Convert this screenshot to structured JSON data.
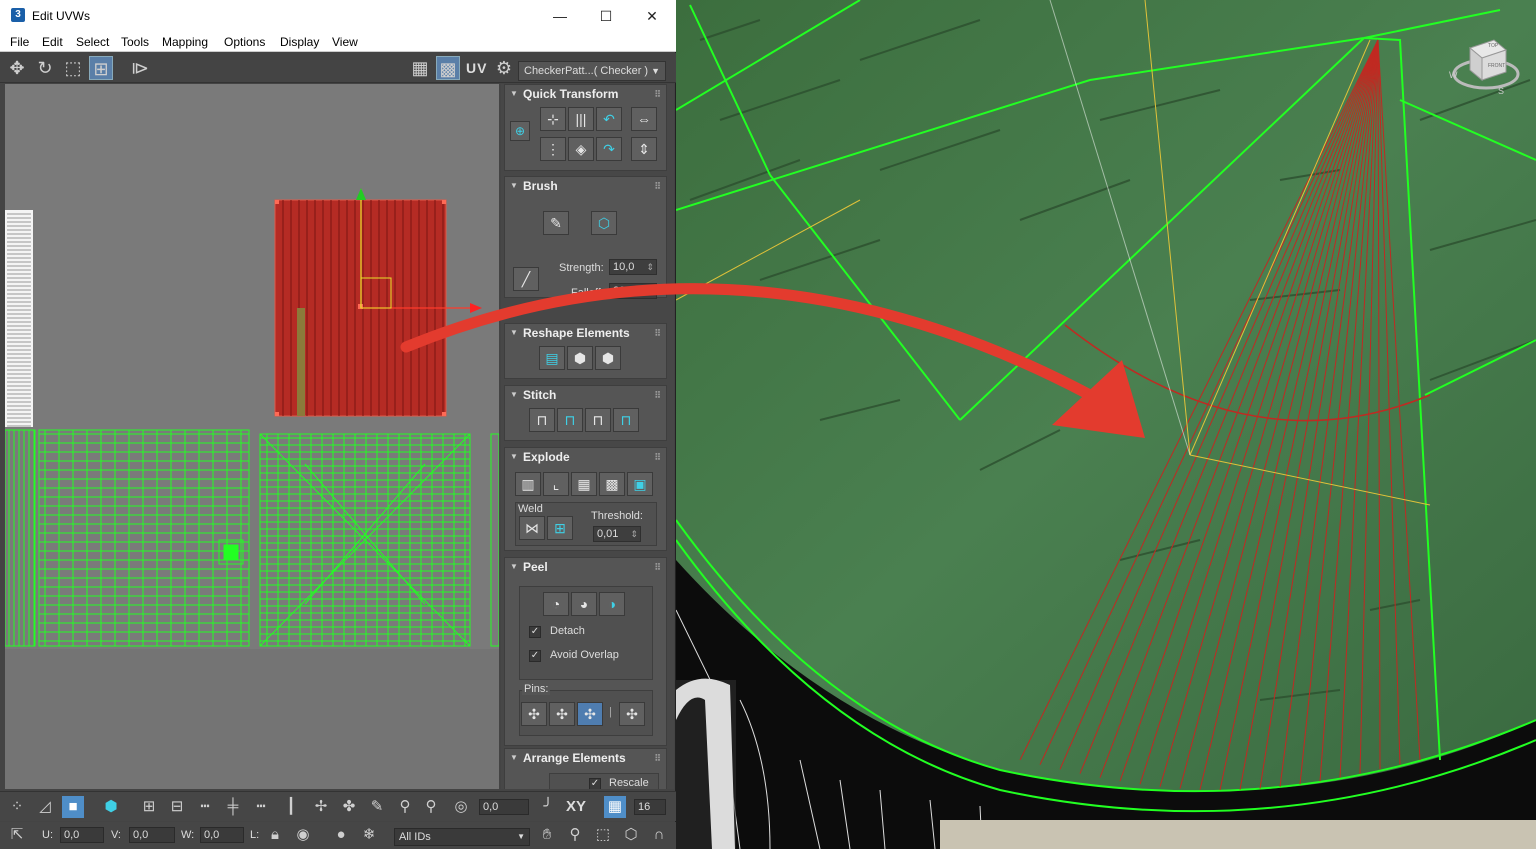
{
  "window": {
    "title": "Edit UVWs",
    "app_icon_label": "3",
    "minimize": "—",
    "maximize": "☐",
    "close": "✕"
  },
  "menu": [
    "File",
    "Edit",
    "Select",
    "Tools",
    "Mapping",
    "Options",
    "Display",
    "View"
  ],
  "toolbar": {
    "uv_label": "UV",
    "texture_dropdown": "CheckerPatt...( Checker )"
  },
  "panel": {
    "quick_transform": "Quick Transform",
    "brush": "Brush",
    "strength_label": "Strength:",
    "strength_value": "10,0",
    "falloff_label": "Falloff:",
    "falloff_value": "20,0",
    "reshape": "Reshape Elements",
    "stitch": "Stitch",
    "explode": "Explode",
    "weld_label": "Weld",
    "threshold_label": "Threshold:",
    "threshold_value": "0,01",
    "peel": "Peel",
    "detach_label": "Detach",
    "avoid_overlap_label": "Avoid Overlap",
    "pins_label": "Pins:",
    "arrange": "Arrange Elements",
    "rescale_label": "Rescale"
  },
  "bottom": {
    "angle_value": "0,0",
    "xy_label": "XY",
    "grid_value": "16",
    "u_label": "U:",
    "u_value": "0,0",
    "v_label": "V:",
    "v_value": "0,0",
    "w_label": "W:",
    "w_value": "0,0",
    "l_label": "L:",
    "ids_dropdown": "All IDs"
  },
  "viewcube": {
    "top": "TOP",
    "front": "FRONT",
    "compass_w": "W",
    "compass_s": "S"
  },
  "colors": {
    "accent": "#4f7db0",
    "wire_green": "#22ff22",
    "selection_red": "#c02a22",
    "arrow_red": "#e33b2e",
    "wood_green": "#3f7a45"
  }
}
